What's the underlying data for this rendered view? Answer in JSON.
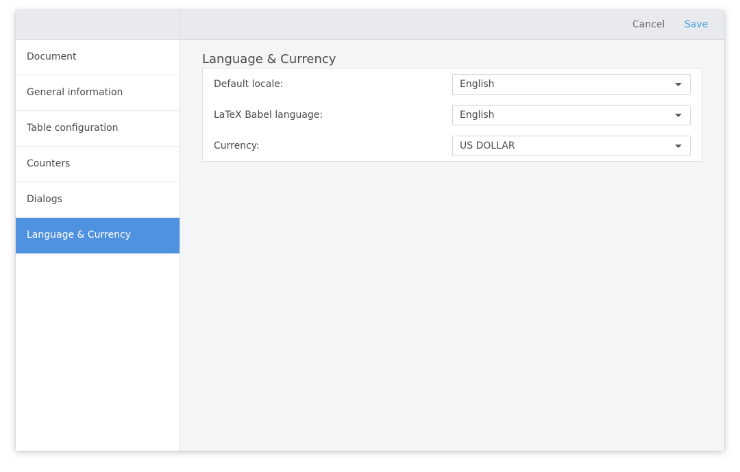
{
  "toolbar": {
    "cancel_label": "Cancel",
    "save_label": "Save"
  },
  "sidebar": {
    "items": [
      {
        "label": "Document"
      },
      {
        "label": "General information"
      },
      {
        "label": "Table configuration"
      },
      {
        "label": "Counters"
      },
      {
        "label": "Dialogs"
      },
      {
        "label": "Language & Currency"
      }
    ],
    "active_index": 5
  },
  "main": {
    "title": "Language & Currency",
    "fields": [
      {
        "label": "Default locale:",
        "value": "English",
        "icon": "caret-down-icon"
      },
      {
        "label": "LaTeX Babel language:",
        "value": "English",
        "icon": "caret-down-icon"
      },
      {
        "label": "Currency:",
        "value": "US DOLLAR",
        "icon": "caret-down-icon"
      }
    ]
  },
  "colors": {
    "accent": "#4f92e0",
    "save_text": "#4aa3df",
    "header_bg": "#e8eaed",
    "content_bg": "#f4f5f7"
  }
}
